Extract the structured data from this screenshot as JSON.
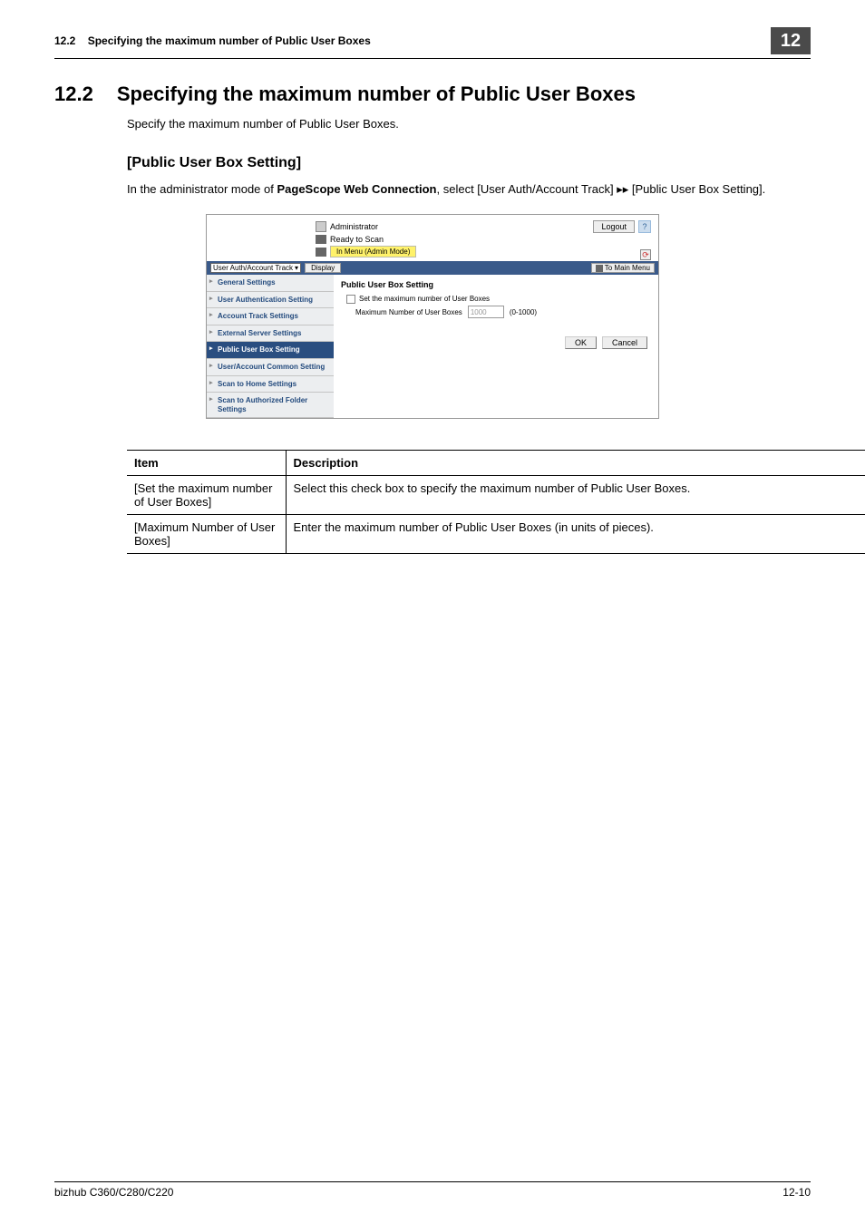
{
  "header": {
    "section_ref": "12.2",
    "title": "Specifying the maximum number of Public User Boxes",
    "chapter_num": "12"
  },
  "section": {
    "num": "12.2",
    "title": "Specifying the maximum number of Public User Boxes",
    "intro": "Specify the maximum number of Public User Boxes.",
    "subheading": "[Public User Box Setting]",
    "body_prefix": "In the administrator mode of ",
    "body_bold": "PageScope Web Connection",
    "body_suffix": ", select [User Auth/Account Track] ▸▸ [Public User Box Setting]."
  },
  "embed": {
    "admin_label": "Administrator",
    "logout": "Logout",
    "help": "?",
    "status_ready": "Ready to Scan",
    "status_menu": "In Menu (Admin Mode)",
    "select_value": "User Auth/Account Track",
    "display_btn": "Display",
    "main_menu": "To Main Menu",
    "sidebar": {
      "items": [
        {
          "label": "General Settings"
        },
        {
          "label": "User Authentication Setting"
        },
        {
          "label": "Account Track Settings"
        },
        {
          "label": "External Server Settings"
        },
        {
          "label": "Public User Box Setting"
        },
        {
          "label": "User/Account Common Setting"
        },
        {
          "label": "Scan to Home Settings"
        },
        {
          "label": "Scan to Authorized Folder Settings"
        }
      ]
    },
    "content": {
      "title": "Public User Box Setting",
      "checkbox_label": "Set the maximum number of User Boxes",
      "field_label": "Maximum Number of User Boxes",
      "field_value": "1000",
      "range": "(0-1000)",
      "ok": "OK",
      "cancel": "Cancel"
    }
  },
  "table": {
    "head_item": "Item",
    "head_desc": "Description",
    "rows": [
      {
        "item": "[Set the maximum number of User Boxes]",
        "desc": "Select this check box to specify the maximum number of Public User Boxes."
      },
      {
        "item": "[Maximum Number of User Boxes]",
        "desc": "Enter the maximum number of Public User Boxes (in units of pieces)."
      }
    ]
  },
  "footer": {
    "left": "bizhub C360/C280/C220",
    "right": "12-10"
  }
}
